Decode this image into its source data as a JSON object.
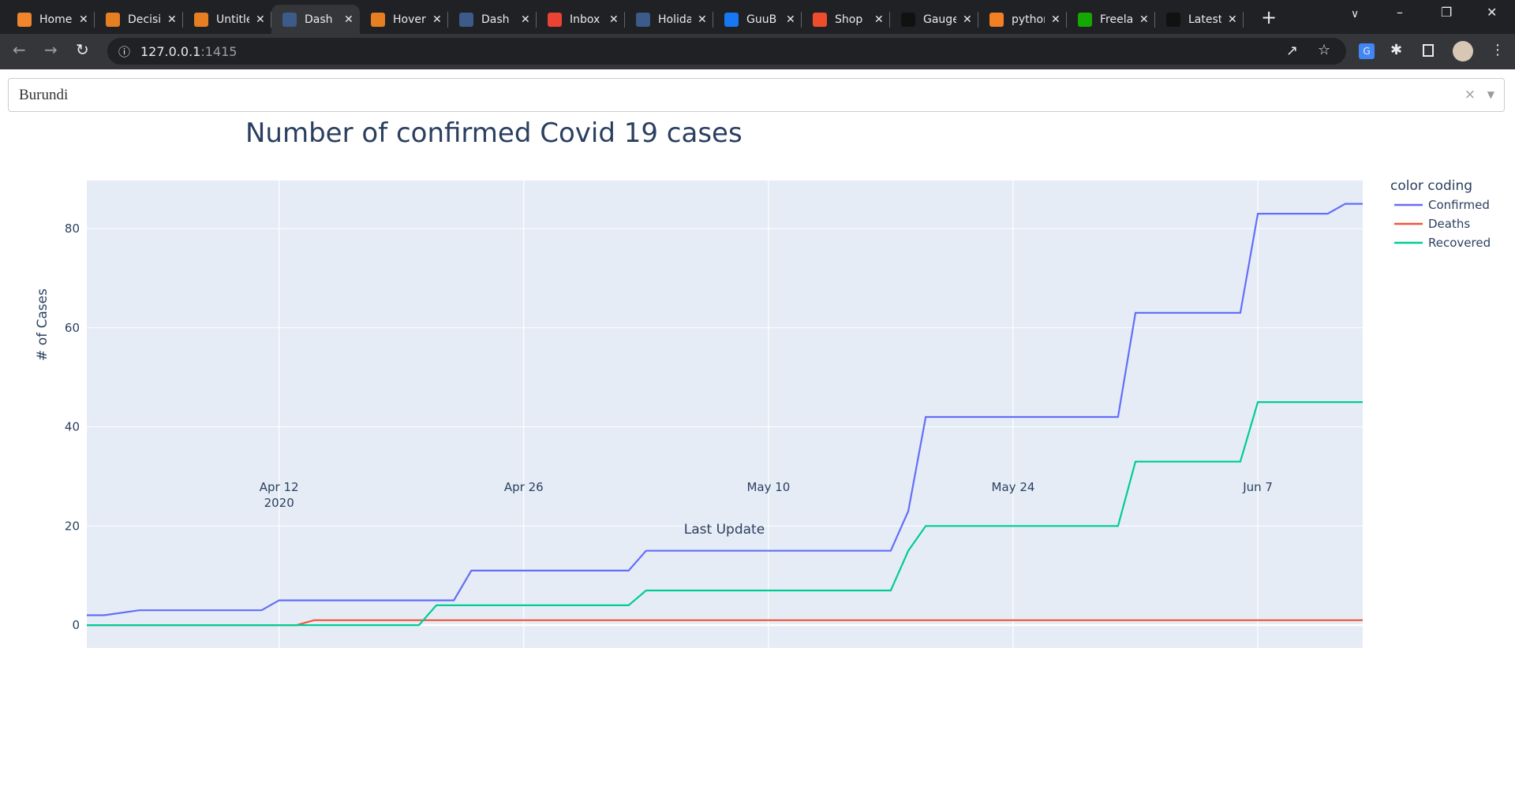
{
  "browser": {
    "tabs": [
      {
        "label": "Home",
        "icon": "spinner-icon",
        "color": "#f0852d",
        "active": false
      },
      {
        "label": "Decision",
        "icon": "book-icon",
        "color": "#e67e22",
        "active": false
      },
      {
        "label": "Untitled",
        "icon": "hourglass-icon",
        "color": "#e67e22",
        "active": false
      },
      {
        "label": "Dash",
        "icon": "dash-icon",
        "color": "#3c5a8a",
        "active": true
      },
      {
        "label": "Hover",
        "icon": "book-icon",
        "color": "#e67e22",
        "active": false
      },
      {
        "label": "Dash",
        "icon": "dash-icon",
        "color": "#3c5a8a",
        "active": false
      },
      {
        "label": "Inbox",
        "icon": "gmail-icon",
        "color": "#ea4335",
        "active": false
      },
      {
        "label": "Holiday",
        "icon": "dash-icon",
        "color": "#3c5a8a",
        "active": false
      },
      {
        "label": "GuuB",
        "icon": "facebook-icon",
        "color": "#1877f2",
        "active": false
      },
      {
        "label": "Shop",
        "icon": "shopee-icon",
        "color": "#ee4d2d",
        "active": false
      },
      {
        "label": "Gauge",
        "icon": "dash-icon",
        "color": "#111111",
        "active": false
      },
      {
        "label": "python",
        "icon": "stackoverflow-icon",
        "color": "#f48024",
        "active": false
      },
      {
        "label": "Freelance",
        "icon": "upwork-icon",
        "color": "#14a800",
        "active": false
      },
      {
        "label": "Latest",
        "icon": "dash-icon",
        "color": "#111111",
        "active": false
      }
    ],
    "url_host": "127.0.0.1",
    "url_port": ":1415"
  },
  "dropdown": {
    "value": "Burundi"
  },
  "chart_data": {
    "type": "line",
    "title": "Number of confirmed Covid 19 cases",
    "xlabel": "Last Update",
    "ylabel": "# of Cases",
    "xlim": [
      "2020-04-01",
      "2020-06-13"
    ],
    "ylim": [
      -4.6,
      89.7
    ],
    "x_ticks": [
      {
        "date": "2020-04-12",
        "label": "Apr 12",
        "sublabel": "2020"
      },
      {
        "date": "2020-04-26",
        "label": "Apr 26",
        "sublabel": ""
      },
      {
        "date": "2020-05-10",
        "label": "May 10",
        "sublabel": ""
      },
      {
        "date": "2020-05-24",
        "label": "May 24",
        "sublabel": ""
      },
      {
        "date": "2020-06-07",
        "label": "Jun 7",
        "sublabel": ""
      }
    ],
    "y_ticks": [
      0,
      20,
      40,
      60,
      80
    ],
    "grid": true,
    "legend": {
      "title": "color coding",
      "placement": "right"
    },
    "series": [
      {
        "name": "Confirmed",
        "color": "#636efa",
        "points": [
          [
            "2020-04-01",
            2
          ],
          [
            "2020-04-02",
            2
          ],
          [
            "2020-04-04",
            3
          ],
          [
            "2020-04-11",
            3
          ],
          [
            "2020-04-12",
            5
          ],
          [
            "2020-04-22",
            5
          ],
          [
            "2020-04-23",
            11
          ],
          [
            "2020-05-02",
            11
          ],
          [
            "2020-05-03",
            15
          ],
          [
            "2020-05-17",
            15
          ],
          [
            "2020-05-18",
            23
          ],
          [
            "2020-05-19",
            42
          ],
          [
            "2020-05-30",
            42
          ],
          [
            "2020-05-31",
            63
          ],
          [
            "2020-06-06",
            63
          ],
          [
            "2020-06-07",
            83
          ],
          [
            "2020-06-11",
            83
          ],
          [
            "2020-06-12",
            85
          ],
          [
            "2020-06-13",
            85
          ]
        ]
      },
      {
        "name": "Deaths",
        "color": "#ef553b",
        "points": [
          [
            "2020-04-01",
            0
          ],
          [
            "2020-04-13",
            0
          ],
          [
            "2020-04-14",
            1
          ],
          [
            "2020-06-13",
            1
          ]
        ]
      },
      {
        "name": "Recovered",
        "color": "#00cc96",
        "points": [
          [
            "2020-04-01",
            0
          ],
          [
            "2020-04-20",
            0
          ],
          [
            "2020-04-21",
            4
          ],
          [
            "2020-05-02",
            4
          ],
          [
            "2020-05-03",
            7
          ],
          [
            "2020-05-17",
            7
          ],
          [
            "2020-05-18",
            15
          ],
          [
            "2020-05-19",
            20
          ],
          [
            "2020-05-30",
            20
          ],
          [
            "2020-05-31",
            33
          ],
          [
            "2020-06-06",
            33
          ],
          [
            "2020-06-07",
            45
          ],
          [
            "2020-06-13",
            45
          ]
        ]
      }
    ]
  }
}
